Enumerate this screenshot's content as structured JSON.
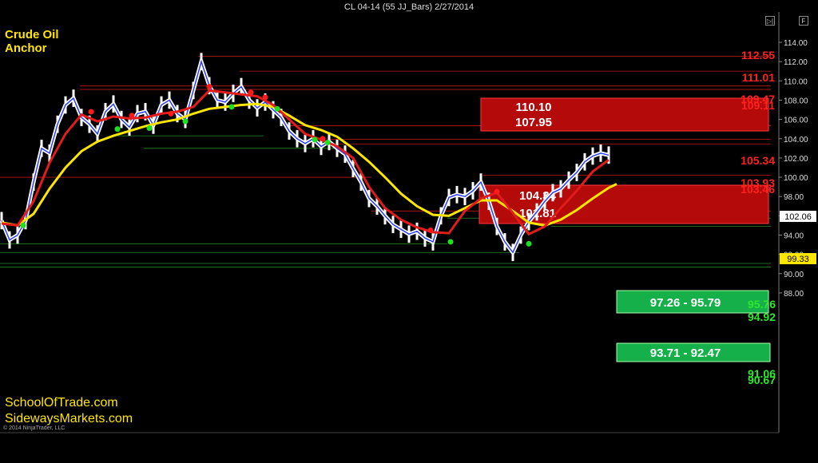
{
  "title": "CL 04-14 (55 JJ_Bars)  2/27/2014",
  "brand": {
    "line1": "Crude Oil",
    "line2": "Anchor",
    "site1": "SchoolOfTrade.com",
    "site2": "SidewaysMarkets.com",
    "copyright": "© 2014 NinjaTrader, LLC"
  },
  "toolbar": {
    "left_icon": "▷|",
    "right_icon": "F"
  },
  "colors": {
    "price": "#ffffff",
    "price_inner": "#2a3cff",
    "red_ma": "#e21b1b",
    "yellow_ma": "#ffe600",
    "red_zone": "#b40a0a",
    "green_zone": "#16b04a",
    "red_level_text": "#ff2020",
    "green_level_text": "#2ee62e",
    "price_tag": "#ffffff",
    "yellow_tag": "#ffe600"
  },
  "chart_data": {
    "type": "line",
    "title": "CL 04-14 (55 JJ_Bars)  2/27/2014",
    "ylim": [
      88,
      115
    ],
    "yticks": [
      "114.00",
      "112.00",
      "110.00",
      "108.00",
      "106.00",
      "104.00",
      "102.00",
      "100.00",
      "98.00",
      "96.00",
      "94.00",
      "92.00",
      "90.00",
      "88.00"
    ],
    "current_price": "102.06",
    "yellow_ma_value": "99.33",
    "series": [
      {
        "role": "price",
        "x": [
          0,
          10,
          20,
          30,
          40,
          50,
          60,
          70,
          80,
          90,
          100,
          110,
          120,
          130,
          140,
          150,
          160,
          170,
          180,
          190,
          200,
          210,
          220,
          230,
          240,
          250,
          260,
          270,
          280,
          290,
          300,
          310,
          320,
          330,
          340,
          350,
          360,
          370,
          380,
          390,
          400,
          410,
          420,
          430,
          440,
          450,
          460,
          470,
          480,
          490,
          500,
          510,
          520,
          530,
          540,
          550,
          560,
          570,
          580,
          590,
          600,
          610,
          620,
          630,
          640,
          650,
          660,
          670,
          680,
          690,
          700,
          710,
          720,
          730,
          740,
          750,
          760
        ],
        "y": [
          95.5,
          93.5,
          94.0,
          95.5,
          99.5,
          103.0,
          102.5,
          105.5,
          107.5,
          108.2,
          106.2,
          105.5,
          104.5,
          106.8,
          107.6,
          106.0,
          105.2,
          106.6,
          106.8,
          105.4,
          107.5,
          108.0,
          106.6,
          106.0,
          109.0,
          112.0,
          109.5,
          108.0,
          107.8,
          108.7,
          109.4,
          108.0,
          107.2,
          107.8,
          107.0,
          106.2,
          104.8,
          104.0,
          103.5,
          104.0,
          103.2,
          103.7,
          103.0,
          102.4,
          100.9,
          99.5,
          97.8,
          97.0,
          96.0,
          95.1,
          94.6,
          94.1,
          94.4,
          93.7,
          93.3,
          96.0,
          97.9,
          98.2,
          98.0,
          98.6,
          99.5,
          97.5,
          94.9,
          93.3,
          92.2,
          94.0,
          95.4,
          96.4,
          97.5,
          98.4,
          98.8,
          99.7,
          100.5,
          101.6,
          102.2,
          102.5,
          102.3
        ]
      },
      {
        "role": "red-moving-average",
        "x": [
          0,
          20,
          40,
          60,
          80,
          100,
          120,
          140,
          160,
          180,
          200,
          220,
          240,
          260,
          280,
          300,
          320,
          340,
          360,
          380,
          400,
          420,
          440,
          460,
          480,
          500,
          520,
          540,
          560,
          580,
          600,
          620,
          640,
          660,
          680,
          700,
          720,
          740,
          760
        ],
        "y": [
          95.2,
          95.0,
          97.5,
          101.5,
          104.5,
          106.5,
          105.8,
          106.3,
          106.1,
          106.2,
          106.6,
          106.8,
          107.3,
          109.0,
          108.8,
          108.6,
          108.4,
          107.5,
          106.0,
          104.5,
          103.9,
          103.2,
          102.0,
          99.0,
          96.8,
          95.6,
          94.8,
          94.3,
          94.2,
          96.5,
          97.8,
          98.4,
          96.3,
          94.1,
          94.9,
          96.8,
          98.6,
          100.6,
          101.8
        ]
      },
      {
        "role": "yellow-moving-average",
        "x": [
          0,
          20,
          40,
          60,
          80,
          100,
          120,
          140,
          160,
          180,
          200,
          220,
          240,
          260,
          280,
          300,
          320,
          340,
          360,
          380,
          400,
          420,
          440,
          460,
          480,
          500,
          520,
          540,
          560,
          580,
          600,
          620,
          640,
          660,
          680,
          700,
          720,
          740,
          760,
          770
        ],
        "y": [
          95.3,
          95.0,
          96.2,
          98.8,
          101.0,
          102.7,
          103.7,
          104.3,
          104.8,
          105.3,
          105.7,
          106.0,
          106.6,
          107.1,
          107.3,
          107.5,
          107.6,
          107.3,
          106.4,
          105.4,
          104.9,
          104.2,
          103.0,
          101.6,
          100.0,
          98.3,
          97.0,
          96.1,
          96.0,
          96.8,
          97.6,
          97.6,
          96.5,
          95.3,
          95.0,
          95.6,
          96.6,
          97.8,
          98.9,
          99.3
        ]
      }
    ],
    "red_zones": [
      {
        "upper": "110.10",
        "lower": "107.95"
      },
      {
        "upper": "104.34",
        "lower": "101.81"
      }
    ],
    "green_zones": [
      {
        "label": "97.26 - 95.79"
      },
      {
        "label": "93.71 - 92.47"
      }
    ],
    "red_levels": [
      "112.55",
      "111.01",
      "109.47",
      "109.11",
      "105.34",
      "103.93",
      "103.46"
    ],
    "green_levels": [
      "95.76",
      "94.92",
      "91.06",
      "90.67"
    ]
  }
}
